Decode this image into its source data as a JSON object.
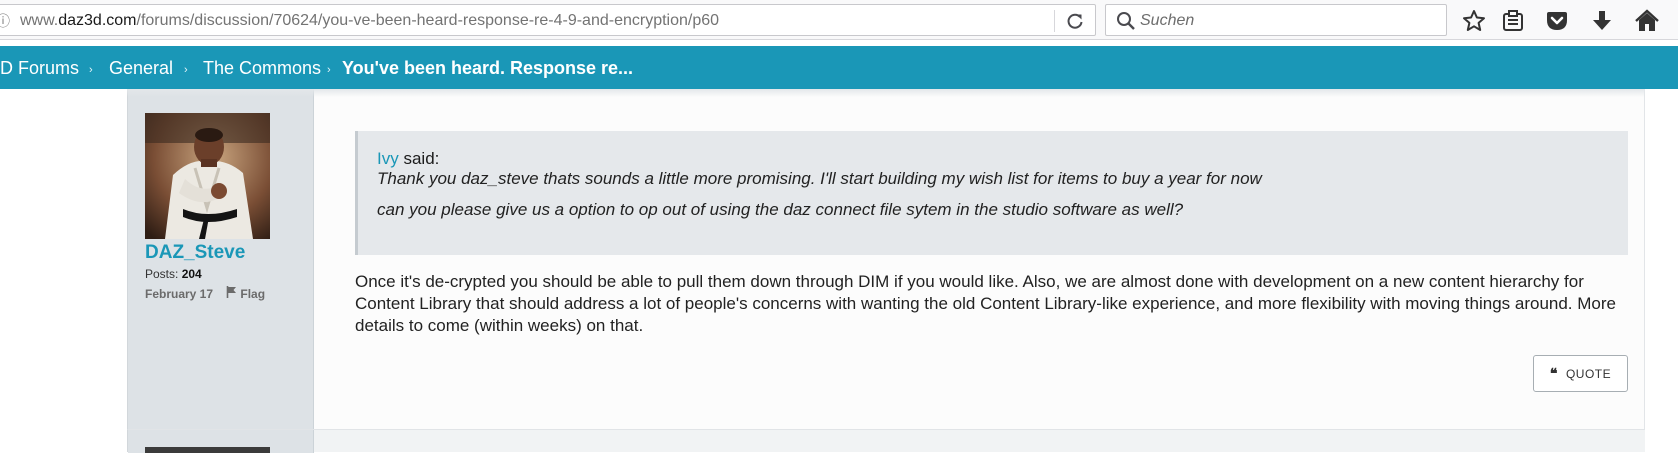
{
  "browser": {
    "url_prefix": "www.",
    "url_host": "daz3d.com",
    "url_path": "/forums/discussion/70624/you-ve-been-heard-response-re-4-9-and-encryption/p60",
    "search_placeholder": "Suchen"
  },
  "breadcrumb": {
    "items": [
      "D Forums",
      "General",
      "The Commons"
    ],
    "current": "You've been heard. Response re...",
    "separator": "›"
  },
  "post": {
    "author": {
      "username": "DAZ_Steve",
      "posts_label": "Posts:",
      "posts_count": "204",
      "date": "February 17",
      "flag_label": "Flag"
    },
    "quote": {
      "quoted_user": "Ivy",
      "said_label": "said:",
      "line1": "Thank you daz_steve thats sounds a little more promising. I'll start building my wish list for items to buy a year for now",
      "line2": "can you please give us a option to op out of using the daz connect file sytem in the studio software as well?"
    },
    "body": "Once it's de-crypted you should be able to pull them down through DIM if you would like.  Also, we are almost done with development on a new content hierarchy for Content Library that should address a lot of people's concerns with wanting the old Content Library-like experience, and more flexibility with moving things around.  More details to come (within weeks) on that.",
    "quote_button": "QUOTE"
  },
  "colors": {
    "brand": "#1a97b7",
    "author_panel": "#dde2e6",
    "quote_bg": "#e5e8eb"
  },
  "icons": [
    "info-icon",
    "reload-icon",
    "search-icon",
    "bookmark-star-icon",
    "reading-list-icon",
    "pocket-icon",
    "download-icon",
    "home-icon",
    "flag-icon",
    "quote-icon"
  ]
}
